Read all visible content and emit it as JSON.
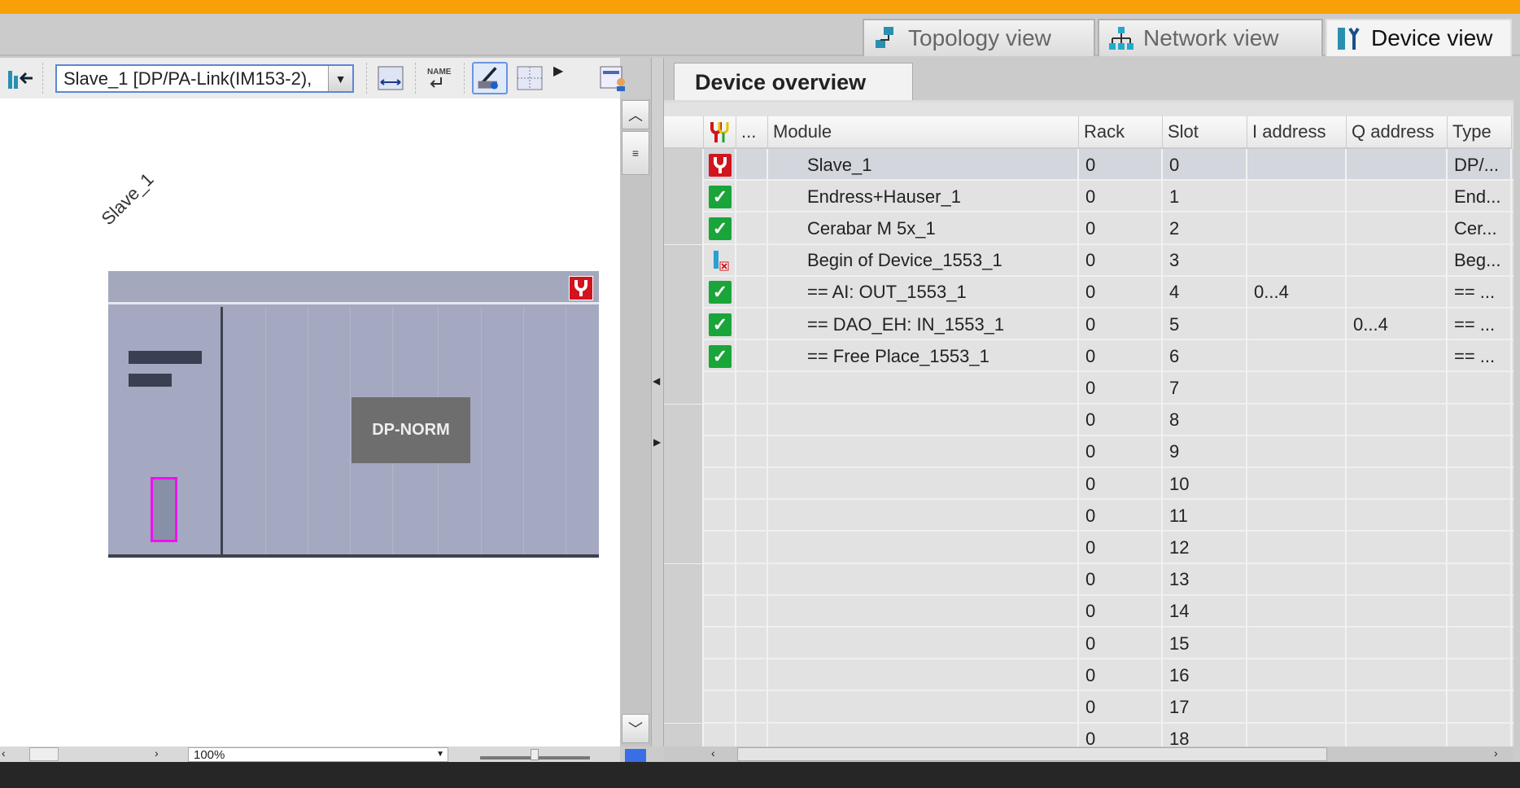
{
  "view_tabs": [
    {
      "label": "Topology view",
      "icon": "topology-icon"
    },
    {
      "label": "Network view",
      "icon": "network-icon"
    },
    {
      "label": "Device view",
      "icon": "device-icon",
      "active": true
    }
  ],
  "toolbar": {
    "device_select_value": "Slave_1 [DP/PA-Link(IM153-2),"
  },
  "canvas": {
    "device_label": "Slave_1",
    "module_label": "DP-NORM",
    "zoom_value": "100%"
  },
  "overview": {
    "tab_label": "Device overview",
    "columns": {
      "dots": "...",
      "module": "Module",
      "rack": "Rack",
      "slot": "Slot",
      "i_address": "I address",
      "q_address": "Q address",
      "type": "Type"
    },
    "rows": [
      {
        "status": "error",
        "module": "Slave_1",
        "rack": "0",
        "slot": "0",
        "i": "",
        "q": "",
        "type": "DP/..."
      },
      {
        "status": "ok",
        "module": "Endress+Hauser_1",
        "rack": "0",
        "slot": "1",
        "i": "",
        "q": "",
        "type": "End..."
      },
      {
        "status": "ok",
        "module": "Cerabar M 5x_1",
        "rack": "0",
        "slot": "2",
        "i": "",
        "q": "",
        "type": "Cer..."
      },
      {
        "status": "missing",
        "module": "Begin of Device_1553_1",
        "rack": "0",
        "slot": "3",
        "i": "",
        "q": "",
        "type": "Beg..."
      },
      {
        "status": "ok",
        "module": "== AI: OUT_1553_1",
        "rack": "0",
        "slot": "4",
        "i": "0...4",
        "q": "",
        "type": "== ..."
      },
      {
        "status": "ok",
        "module": "== DAO_EH: IN_1553_1",
        "rack": "0",
        "slot": "5",
        "i": "",
        "q": "0...4",
        "type": "== ..."
      },
      {
        "status": "ok",
        "module": "== Free Place_1553_1",
        "rack": "0",
        "slot": "6",
        "i": "",
        "q": "",
        "type": "== ..."
      },
      {
        "status": "",
        "module": "",
        "rack": "0",
        "slot": "7",
        "i": "",
        "q": "",
        "type": ""
      },
      {
        "status": "",
        "module": "",
        "rack": "0",
        "slot": "8",
        "i": "",
        "q": "",
        "type": ""
      },
      {
        "status": "",
        "module": "",
        "rack": "0",
        "slot": "9",
        "i": "",
        "q": "",
        "type": ""
      },
      {
        "status": "",
        "module": "",
        "rack": "0",
        "slot": "10",
        "i": "",
        "q": "",
        "type": ""
      },
      {
        "status": "",
        "module": "",
        "rack": "0",
        "slot": "11",
        "i": "",
        "q": "",
        "type": ""
      },
      {
        "status": "",
        "module": "",
        "rack": "0",
        "slot": "12",
        "i": "",
        "q": "",
        "type": ""
      },
      {
        "status": "",
        "module": "",
        "rack": "0",
        "slot": "13",
        "i": "",
        "q": "",
        "type": ""
      },
      {
        "status": "",
        "module": "",
        "rack": "0",
        "slot": "14",
        "i": "",
        "q": "",
        "type": ""
      },
      {
        "status": "",
        "module": "",
        "rack": "0",
        "slot": "15",
        "i": "",
        "q": "",
        "type": ""
      },
      {
        "status": "",
        "module": "",
        "rack": "0",
        "slot": "16",
        "i": "",
        "q": "",
        "type": ""
      },
      {
        "status": "",
        "module": "",
        "rack": "0",
        "slot": "17",
        "i": "",
        "q": "",
        "type": ""
      },
      {
        "status": "",
        "module": "",
        "rack": "0",
        "slot": "18",
        "i": "",
        "q": "",
        "type": ""
      }
    ]
  },
  "colors": {
    "title_bar": "#f9a008",
    "ok": "#1aa53a",
    "error": "#d2141e",
    "selection_frame": "#f010f0"
  }
}
